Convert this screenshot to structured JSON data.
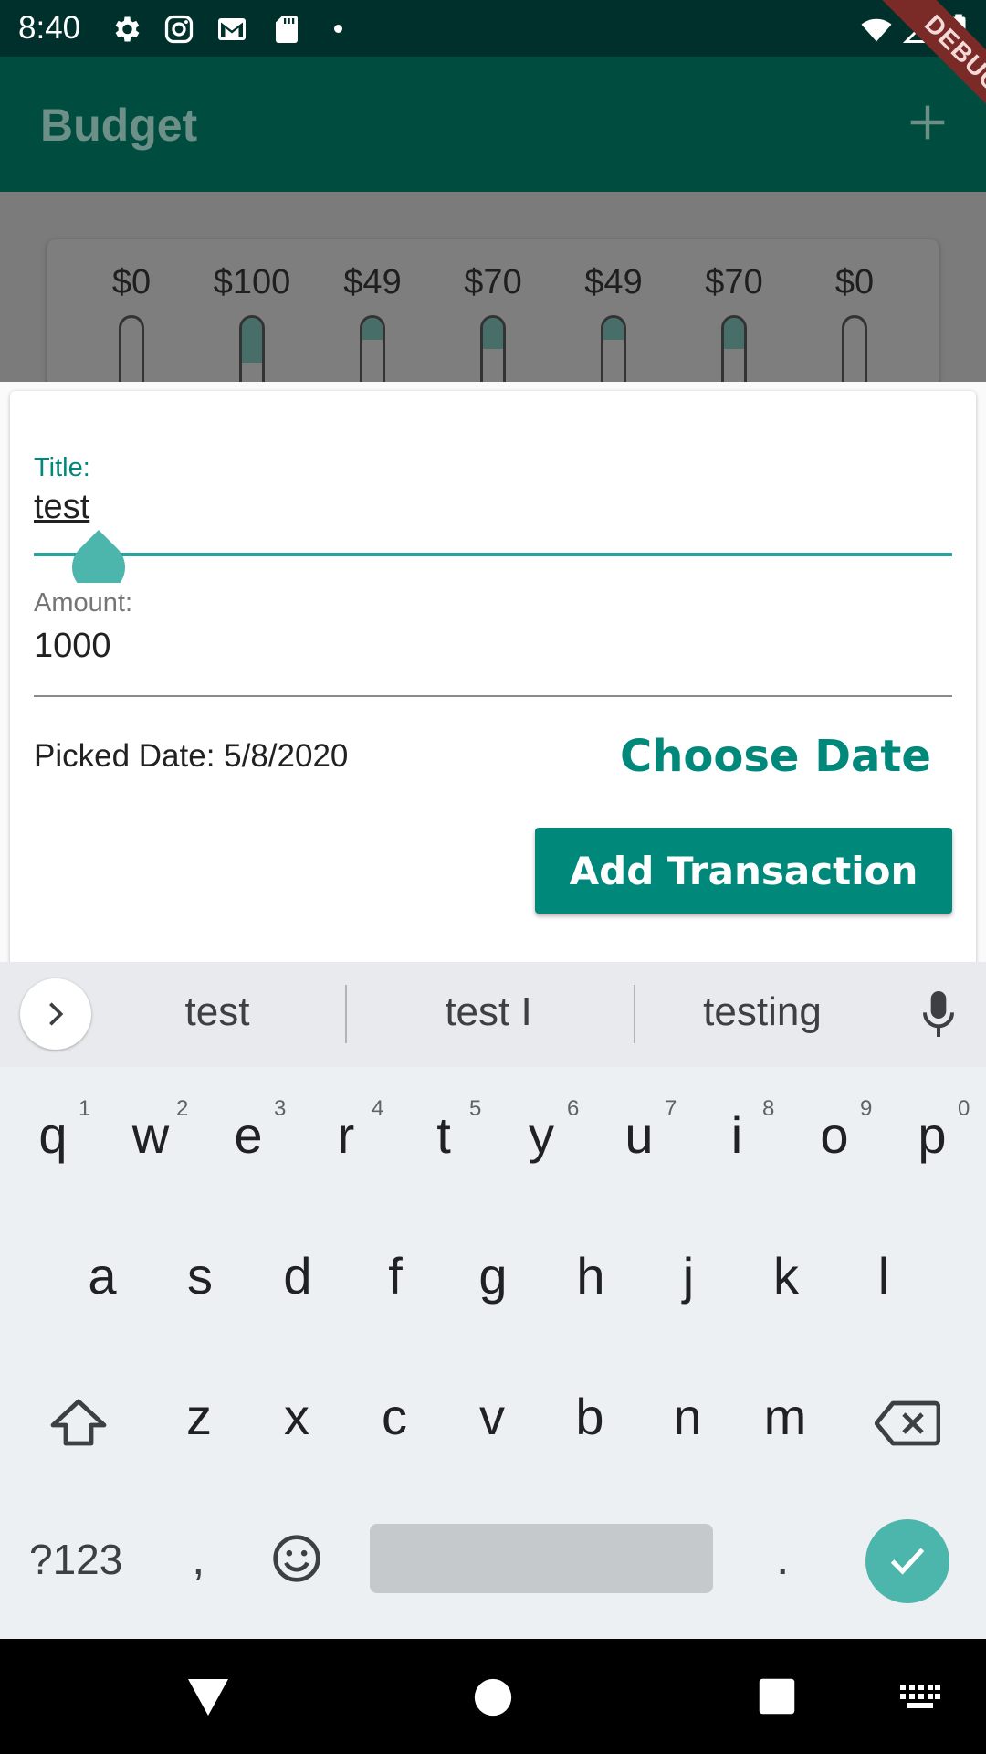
{
  "status_bar": {
    "time": "8:40",
    "left_icons": [
      "gear-icon",
      "instagram-icon",
      "gmail-icon",
      "sd-card-icon"
    ],
    "right_icons": [
      "wifi-icon",
      "cellular-icon",
      "battery-icon"
    ]
  },
  "debug_banner": "DEBUG",
  "app_bar": {
    "title": "Budget",
    "action_icon": "add-icon"
  },
  "chart": {
    "bars": [
      {
        "label": "$0",
        "fill": 0.0
      },
      {
        "label": "$100",
        "fill": 0.43
      },
      {
        "label": "$49",
        "fill": 0.21
      },
      {
        "label": "$70",
        "fill": 0.3
      },
      {
        "label": "$49",
        "fill": 0.21
      },
      {
        "label": "$70",
        "fill": 0.3
      },
      {
        "label": "$0",
        "fill": 0.0
      }
    ]
  },
  "form": {
    "title_label": "Title:",
    "title_value": "test",
    "amount_label": "Amount:",
    "amount_value": "1000",
    "picked_date_text": "Picked Date: 5/8/2020",
    "choose_date_label": "Choose Date",
    "submit_label": "Add Transaction"
  },
  "keyboard": {
    "suggestions": [
      "test",
      "test I",
      "testing"
    ],
    "row1": [
      "q",
      "w",
      "e",
      "r",
      "t",
      "y",
      "u",
      "i",
      "o",
      "p"
    ],
    "row1_hints": [
      "1",
      "2",
      "3",
      "4",
      "5",
      "6",
      "7",
      "8",
      "9",
      "0"
    ],
    "row2": [
      "a",
      "s",
      "d",
      "f",
      "g",
      "h",
      "j",
      "k",
      "l"
    ],
    "row3": [
      "z",
      "x",
      "c",
      "v",
      "b",
      "n",
      "m"
    ],
    "symbols_label": "?123",
    "comma": ",",
    "period": "."
  },
  "colors": {
    "primary": "#00897b",
    "app_bar": "#004d40",
    "status_bar": "#00302b",
    "accent": "#4db6ac"
  }
}
